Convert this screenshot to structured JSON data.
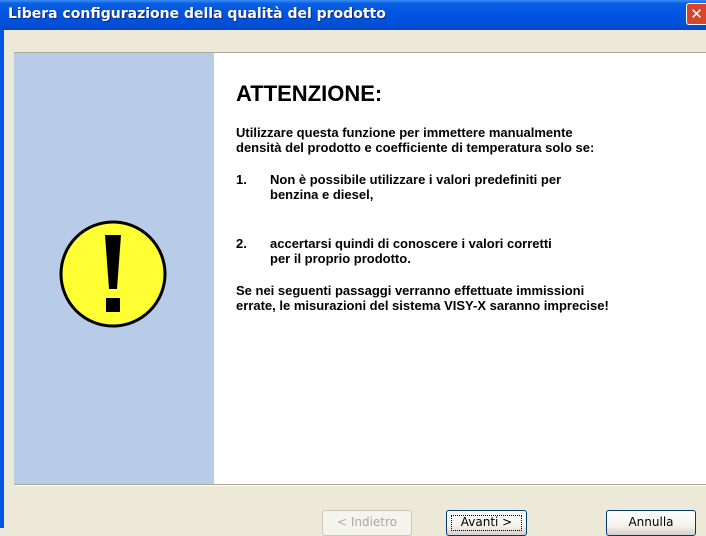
{
  "window": {
    "title": "Libera configurazione della qualità del prodotto",
    "close_glyph": "✕"
  },
  "content": {
    "heading": "ATTENZIONE:",
    "intro_line1": "Utilizzare questa funzione per immettere manualmente",
    "intro_line2": "densità del prodotto e coefficiente di temperatura solo se:",
    "item1": {
      "num": "1.",
      "line1": "Non è possibile utilizzare i valori predefiniti per",
      "line2": "benzina e diesel,"
    },
    "item2": {
      "num": "2.",
      "line1": "accertarsi quindi di conoscere i valori corretti",
      "line2": "per il proprio prodotto."
    },
    "warning_line1": "Se nei seguenti passaggi verranno effettuate immissioni",
    "warning_line2": "errate, le misurazioni del sistema VISY-X saranno imprecise!"
  },
  "buttons": {
    "back": "< Indietro",
    "next": "Avanti >",
    "cancel": "Annulla"
  },
  "icon": {
    "name": "warning-exclamation-icon",
    "fill": "#ffff33",
    "glyph": "!"
  },
  "colors": {
    "titlebar": "#0054e3",
    "sidebar": "#b8cce8",
    "dialog_bg": "#ece9d8"
  }
}
